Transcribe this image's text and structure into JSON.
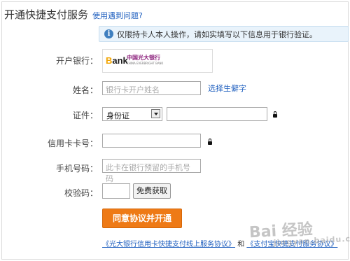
{
  "title": "开通快捷支付服务",
  "help_link": "使用遇到问题?",
  "notice": "仅限持卡人本人操作，请如实填写以下信息用于银行验证。",
  "form": {
    "bank_label": "开户银行：",
    "bank": {
      "logo_text": "Bank",
      "name_cn": "中国光大银行",
      "name_en": "CHINA EVERBRIGHT BANK"
    },
    "name_label": "姓名：",
    "name_placeholder": "银行卡开户姓名",
    "rare_char_link": "选择生僻字",
    "id_label": "证件：",
    "id_type_selected": "身份证",
    "card_label": "信用卡卡号：",
    "phone_label": "手机号码：",
    "phone_placeholder": "此卡在银行预留的手机号码",
    "code_label": "校验码：",
    "get_code_button": "免费获取",
    "submit_button": "同意协议并开通"
  },
  "agreements": {
    "link1": "《光大银行信用卡快捷支付线上服务协议》",
    "and": "和",
    "link2": "《支付宝快捷支付服务协议》"
  },
  "watermark": {
    "main": "Bai 经验",
    "sub": "jingyan.baidu.com"
  }
}
